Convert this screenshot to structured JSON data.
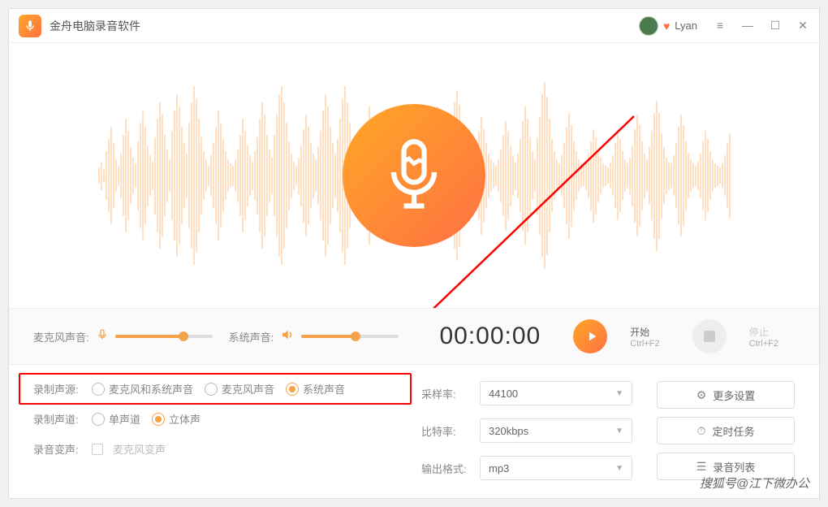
{
  "header": {
    "app_title": "金舟电脑录音软件",
    "username": "Lyan"
  },
  "controls": {
    "mic_label": "麦克风声音:",
    "sys_label": "系统声音:",
    "mic_level": 70,
    "sys_level": 56,
    "timer": "00:00:00",
    "start_label": "开始",
    "start_shortcut": "Ctrl+F2",
    "stop_label": "停止",
    "stop_shortcut": "Ctrl+F2"
  },
  "settings": {
    "source_label": "录制声源:",
    "source_options": [
      "麦克风和系统声音",
      "麦克风声音",
      "系统声音"
    ],
    "source_selected": 2,
    "channel_label": "录制声道:",
    "channel_options": [
      "单声道",
      "立体声"
    ],
    "channel_selected": 1,
    "voice_change_label": "录音变声:",
    "voice_change_option": "麦克风变声",
    "sample_rate_label": "采样率:",
    "sample_rate_value": "44100",
    "bitrate_label": "比特率:",
    "bitrate_value": "320kbps",
    "format_label": "输出格式:",
    "format_value": "mp3"
  },
  "buttons": {
    "more_settings": "更多设置",
    "timed_tasks": "定时任务",
    "recording_list": "录音列表"
  },
  "watermark": "搜狐号@江下微办公"
}
